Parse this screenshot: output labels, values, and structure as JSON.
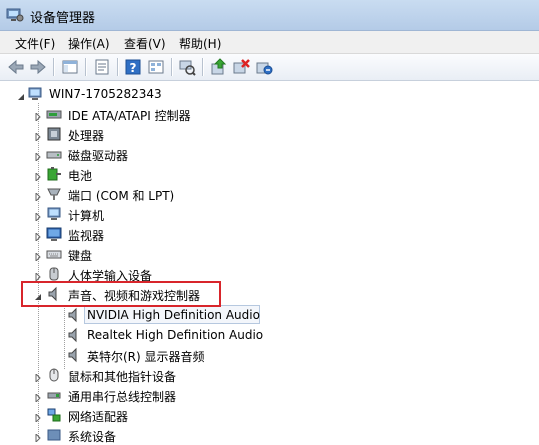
{
  "window": {
    "title": "设备管理器"
  },
  "menu": [
    "文件(F)",
    "操作(A)",
    "查看(V)",
    "帮助(H)"
  ],
  "toolbar": {
    "buttons": [
      "back-arrow-icon",
      "forward-arrow-icon",
      "show-hide-console-tree-icon",
      "properties-icon",
      "help-icon",
      "view-icon",
      "scan-hardware-icon",
      "update-driver-icon",
      "disable-device-icon",
      "uninstall-device-icon"
    ]
  },
  "tree": {
    "root": "WIN7-1705282343",
    "items": [
      {
        "label": "IDE ATA/ATAPI 控制器",
        "icon": "ide-controller-icon",
        "expanded": false
      },
      {
        "label": "处理器",
        "icon": "processor-icon",
        "expanded": false
      },
      {
        "label": "磁盘驱动器",
        "icon": "disk-drive-icon",
        "expanded": false
      },
      {
        "label": "电池",
        "icon": "battery-icon",
        "expanded": false
      },
      {
        "label": "端口 (COM 和 LPT)",
        "icon": "port-icon",
        "expanded": false
      },
      {
        "label": "计算机",
        "icon": "computer-icon",
        "expanded": false
      },
      {
        "label": "监视器",
        "icon": "monitor-icon",
        "expanded": false
      },
      {
        "label": "键盘",
        "icon": "keyboard-icon",
        "expanded": false
      },
      {
        "label": "人体学输入设备",
        "icon": "hid-icon",
        "expanded": false
      },
      {
        "label": "声音、视频和游戏控制器",
        "icon": "speaker-icon",
        "expanded": true,
        "children": [
          {
            "label": "NVIDIA High Definition Audio",
            "icon": "speaker-icon",
            "selected": true
          },
          {
            "label": "Realtek High Definition Audio",
            "icon": "speaker-icon"
          },
          {
            "label": "英特尔(R) 显示器音频",
            "icon": "speaker-icon"
          }
        ]
      },
      {
        "label": "鼠标和其他指针设备",
        "icon": "mouse-icon",
        "expanded": false
      },
      {
        "label": "通用串行总线控制器",
        "icon": "usb-icon",
        "expanded": false
      },
      {
        "label": "网络适配器",
        "icon": "network-adapter-icon",
        "expanded": false
      },
      {
        "label": "系统设备",
        "icon": "system-device-icon",
        "expanded": false
      }
    ]
  },
  "colors": {
    "highlight_border": "#d8252b",
    "selection_border": "#b6c8df"
  }
}
